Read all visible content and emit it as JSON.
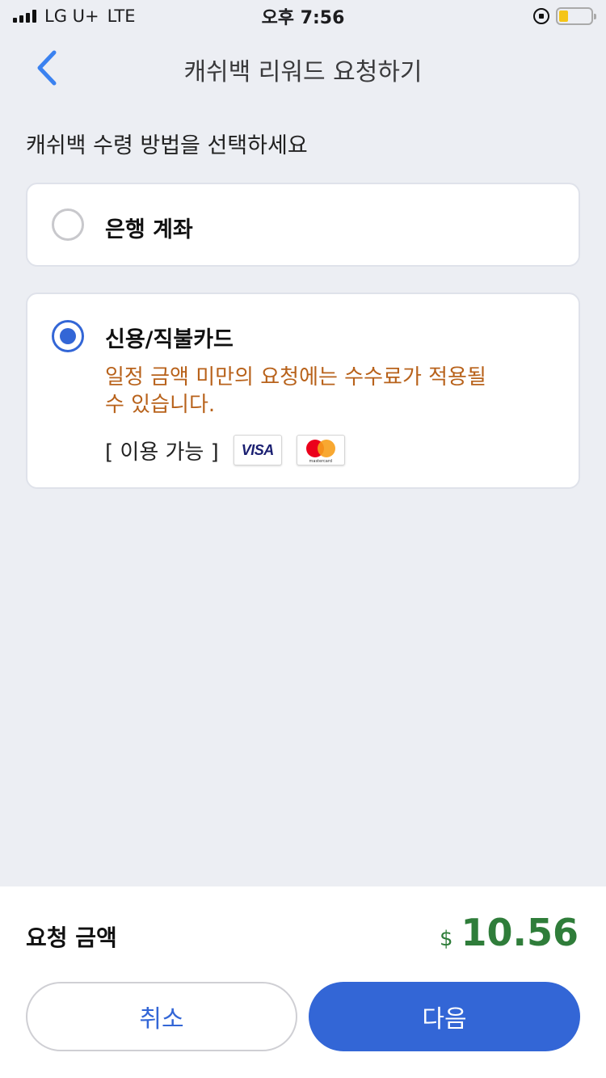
{
  "status_bar": {
    "carrier": "LG U+",
    "network": "LTE",
    "time": "오후 7:56",
    "battery_level_percent": 30
  },
  "nav": {
    "title": "캐쉬백 리워드 요청하기"
  },
  "section_label": "캐쉬백 수령 방법을 선택하세요",
  "options": [
    {
      "label": "은행 계좌",
      "selected": false
    },
    {
      "label": "신용/직불카드",
      "selected": true,
      "note": "일정 금액 미만의 요청에는 수수료가 적용될 수 있습니다.",
      "available_label": "[ 이용 가능 ]",
      "cards": [
        "VISA",
        "mastercard"
      ]
    }
  ],
  "summary": {
    "amount_label": "요청 금액",
    "currency_symbol": "$",
    "amount": "10.56"
  },
  "buttons": {
    "cancel": "취소",
    "next": "다음"
  },
  "colors": {
    "accent": "#3366d6",
    "amount": "#2f7d3a",
    "note": "#b8621b",
    "background": "#eceef3"
  }
}
